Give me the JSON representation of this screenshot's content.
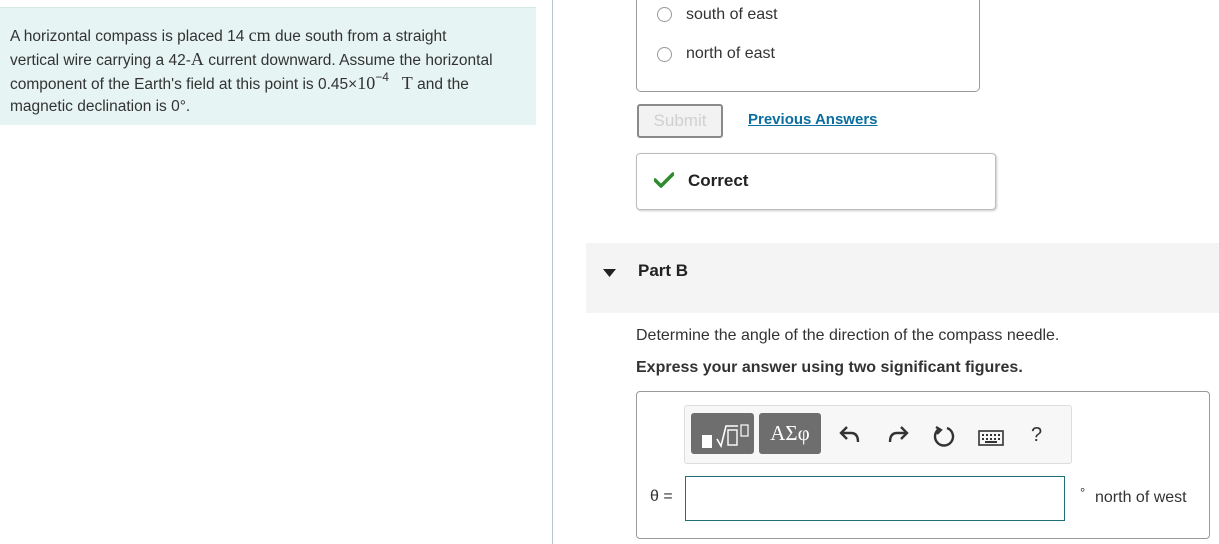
{
  "problem": {
    "p1": "A horizontal compass is placed 14 ",
    "unit_cm": "cm",
    "p2": " due south from a straight",
    "line2a": "vertical wire carrying a 42-",
    "unit_A": "A",
    "line2b": " current downward. Assume the horizontal",
    "line3a": "component of the Earth's field at this point is 0.45×",
    "ten": "10",
    "exp": "−4",
    "unit_T": "T",
    "line3b": " and the",
    "line4": "magnetic declination is 0°."
  },
  "part_a": {
    "options": [
      {
        "label": "south of east"
      },
      {
        "label": "north of east"
      }
    ],
    "submit_label": "Submit",
    "previous_answers_label": "Previous Answers",
    "feedback": "Correct"
  },
  "part_b": {
    "label": "Part B",
    "question": "Determine the angle of the direction of the compass needle.",
    "instruction": "Express your answer using two significant figures.",
    "toolbar": {
      "template_icon": "fraction-sqrt-template-icon",
      "greek_label": "ΑΣφ",
      "undo_icon": "undo-icon",
      "redo_icon": "redo-icon",
      "reset_icon": "reset-icon",
      "keyboard_icon": "keyboard-icon",
      "help_label": "?"
    },
    "variable_label": "θ =",
    "answer_value": "",
    "unit_degree": "°",
    "unit_label": "north of west"
  },
  "colors": {
    "problem_bg": "#e6f4f3",
    "link": "#0a6fa0",
    "check": "#2e8b2e",
    "input_border": "#1f6f78"
  }
}
